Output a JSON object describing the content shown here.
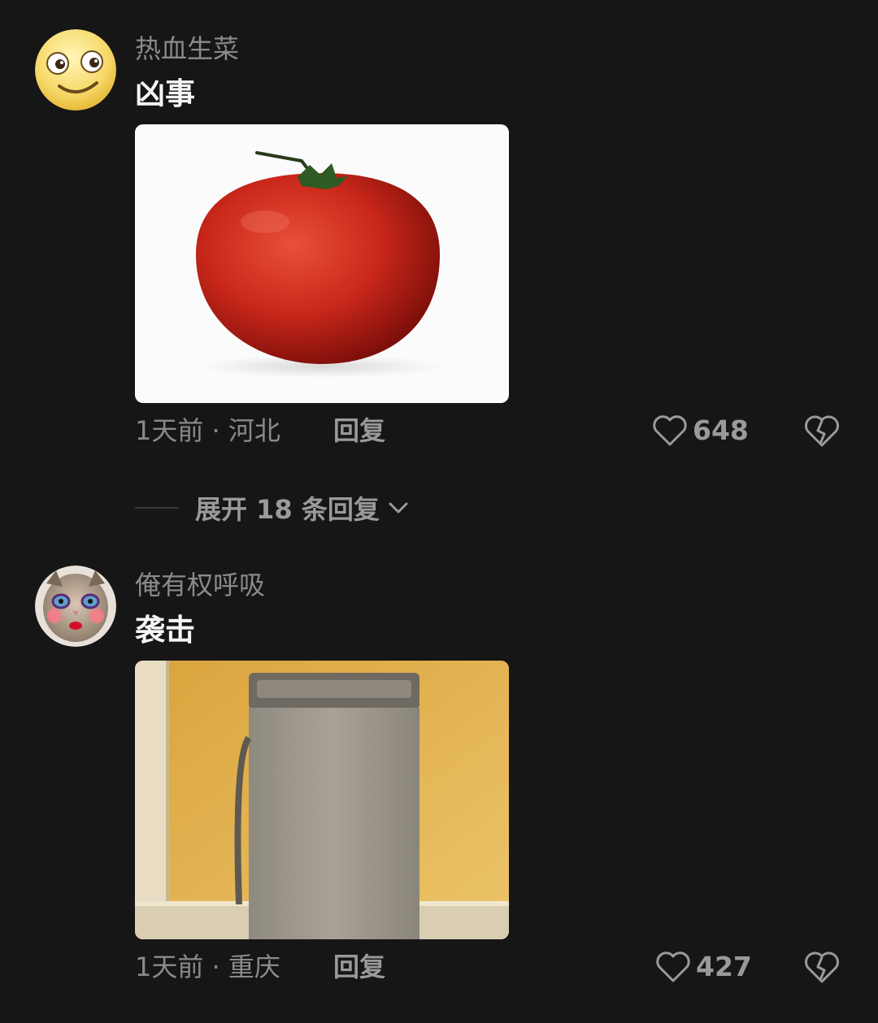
{
  "comments": [
    {
      "username": "热血生菜",
      "text": "凶事",
      "image_icon": "tomato-image",
      "time_location": "1天前 · 河北",
      "reply_label": "回复",
      "likes": "648"
    },
    {
      "username": "俺有权呼吸",
      "text": "袭击",
      "image_icon": "washing-machine-image",
      "time_location": "1天前 · 重庆",
      "reply_label": "回复",
      "likes": "427"
    }
  ],
  "expand_replies": {
    "label": "展开 18 条回复"
  },
  "colors": {
    "background": "#161616",
    "muted": "#8a8a8a",
    "text": "#f5f5f5"
  }
}
